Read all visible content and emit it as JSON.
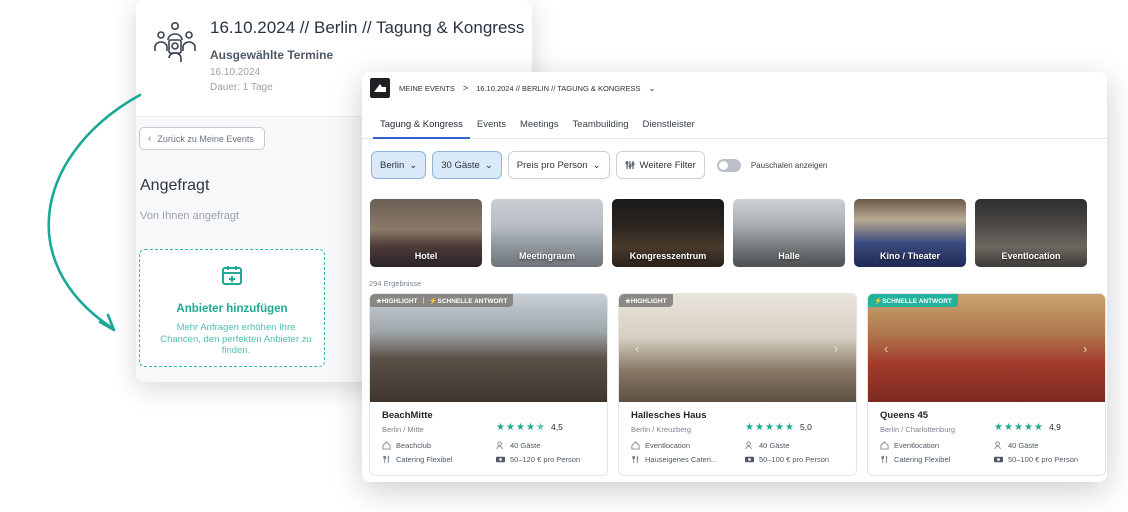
{
  "back_panel": {
    "title": "16.10.2024 // Berlin // Tagung & Kongress",
    "subtitle": "Ausgewählte Termine",
    "date": "16.10.2024",
    "duration": "Dauer: 1 Tage",
    "back_button": "Zurück zu Meine Events",
    "section_title": "Angefragt",
    "section_subtitle": "Von Ihnen angefragt",
    "add_card": {
      "title": "Anbieter hinzufügen",
      "description": "Mehr Anfragen erhöhen Ihre Chancen, den perfekten Anbieter zu finden."
    }
  },
  "breadcrumb": {
    "home": "MEINE EVENTS",
    "separator": ">",
    "current": "16.10.2024 // BERLIN // TAGUNG & KONGRESS"
  },
  "tabs": [
    {
      "label": "Tagung & Kongress",
      "active": true
    },
    {
      "label": "Events",
      "active": false
    },
    {
      "label": "Meetings",
      "active": false
    },
    {
      "label": "Teambuilding",
      "active": false
    },
    {
      "label": "Dienstleister",
      "active": false
    }
  ],
  "filters": {
    "city": "Berlin",
    "guests": "30 Gäste",
    "price": "Preis pro Person",
    "more": "Weitere Filter",
    "toggle_label": "Pauschalen anzeigen"
  },
  "categories": [
    {
      "label": "Hotel"
    },
    {
      "label": "Meetingraum"
    },
    {
      "label": "Kongresszentrum"
    },
    {
      "label": "Halle"
    },
    {
      "label": "Kino / Theater"
    },
    {
      "label": "Eventlocation"
    }
  ],
  "results_count": "294 Ergebnisse",
  "cards": [
    {
      "badge1": "★HIGHLIGHT",
      "badge2": "⚡SCHNELLE ANTWORT",
      "name": "BeachMitte",
      "location": "Berlin / Mitte",
      "rating": "4,5",
      "type": "Beachclub",
      "guests": "40 Gäste",
      "catering": "Catering Flexibel",
      "price": "50–120 € pro Person"
    },
    {
      "badge1": "★HIGHLIGHT",
      "name": "Hallesches Haus",
      "location": "Berlin / Kreuzberg",
      "rating": "5,0",
      "type": "Eventlocation",
      "guests": "40 Gäste",
      "catering": "Hauseigenes Cateri...",
      "price": "50–100 € pro Person"
    },
    {
      "badge1": "⚡SCHNELLE ANTWORT",
      "name": "Queens 45",
      "location": "Berlin / Charlottenburg",
      "rating": "4,9",
      "type": "Eventlocation",
      "guests": "40 Gäste",
      "catering": "Catering Flexibel",
      "price": "50–100 € pro Person"
    }
  ],
  "colors": {
    "accent_teal": "#1fa896",
    "tab_active": "#2f67c9",
    "chip_selected": "#d9e9f7"
  }
}
